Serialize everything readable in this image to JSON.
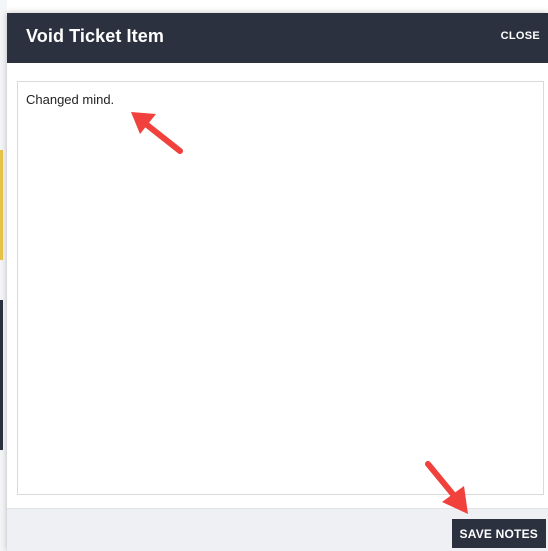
{
  "modal": {
    "title": "Void Ticket Item",
    "close_label": "CLOSE"
  },
  "notes": {
    "value": "Changed mind."
  },
  "footer": {
    "save_label": "SAVE NOTES"
  },
  "colors": {
    "header_bg": "#2c3140",
    "footer_bg": "#eef0f3",
    "annotation_arrow": "#f0413c"
  },
  "annotations": [
    {
      "icon": "red-arrow-icon",
      "points_to": "notes-textarea"
    },
    {
      "icon": "red-arrow-icon",
      "points_to": "save-notes-button"
    }
  ]
}
